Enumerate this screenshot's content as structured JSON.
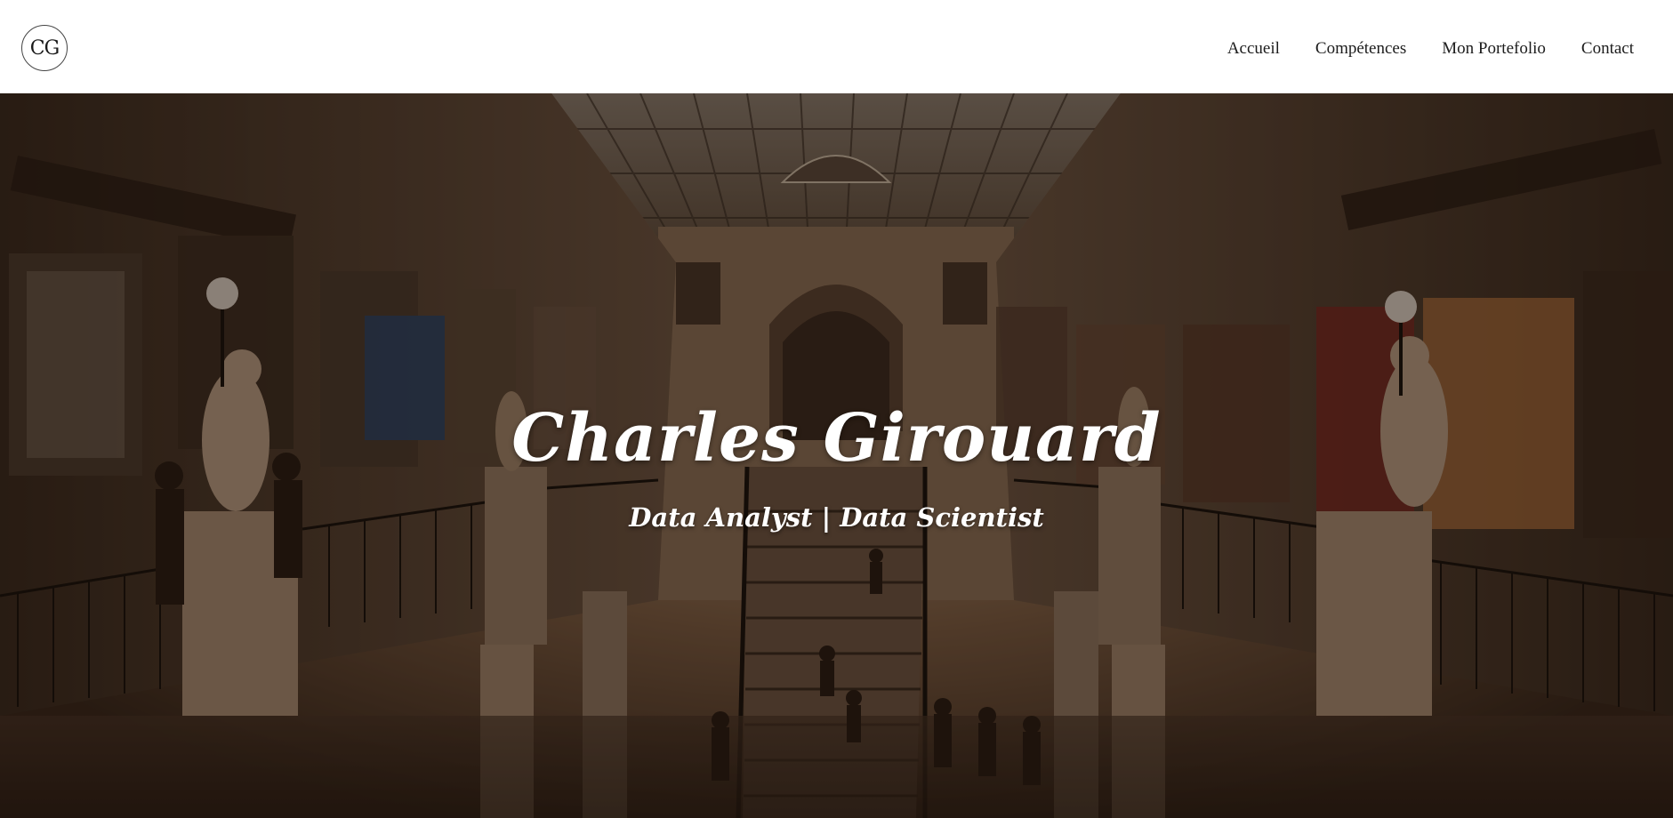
{
  "header": {
    "logo_text": "CG",
    "nav": [
      {
        "label": "Accueil"
      },
      {
        "label": "Compétences"
      },
      {
        "label": "Mon Portefolio"
      },
      {
        "label": "Contact"
      }
    ]
  },
  "hero": {
    "title": "Charles Girouard",
    "subtitle": "Data Analyst | Data Scientist",
    "background": "shopping-arcade-photo"
  },
  "colors": {
    "header_bg": "#ffffff",
    "nav_text": "#1c1c1c",
    "hero_text": "#ffffff",
    "photo_tone": "#5a3f2b"
  }
}
